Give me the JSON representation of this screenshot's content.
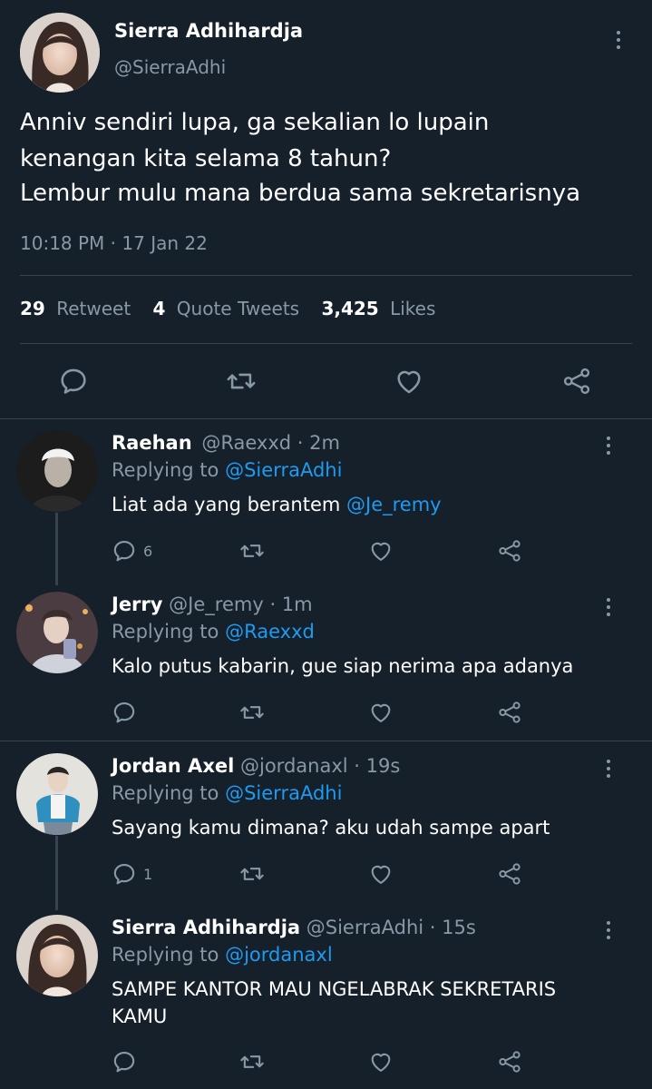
{
  "main_tweet": {
    "author_name": "Sierra Adhihardja",
    "author_handle": "@SierraAdhi",
    "text_lines": [
      "Anniv sendiri lupa, ga sekalian lo lupain",
      "kenangan kita selama 8 tahun?",
      "Lembur mulu mana berdua sama sekretarisnya"
    ],
    "timestamp": "10:18 PM · 17 Jan 22",
    "stats": {
      "retweets_count": "29",
      "retweets_label": "Retweet",
      "quotes_count": "4",
      "quotes_label": "Quote Tweets",
      "likes_count": "3,425",
      "likes_label": "Likes"
    }
  },
  "replies": [
    {
      "name": "Raehan",
      "handle": "@Raexxd",
      "time": "· 2m",
      "replying_prefix": "Replying to",
      "replying_to": "@SierraAdhi",
      "text_lines": [
        "Liat ada yang berantem "
      ],
      "mention": "@Je_remy",
      "reply_count": "6"
    },
    {
      "name": "Jerry",
      "handle": "@Je_remy",
      "time": "· 1m",
      "replying_prefix": "Replying to",
      "replying_to": "@Raexxd",
      "text_lines": [
        "Kalo putus kabarin, gue siap nerima apa adanya"
      ],
      "reply_count": ""
    },
    {
      "name": "Jordan Axel",
      "handle": "@jordanaxl",
      "time": "· 19s",
      "replying_prefix": "Replying to",
      "replying_to": "@SierraAdhi",
      "text_lines": [
        "Sayang kamu dimana? aku udah sampe apart"
      ],
      "reply_count": "1"
    },
    {
      "name": "Sierra Adhihardja",
      "handle": "@SierraAdhi",
      "time": "· 15s",
      "replying_prefix": "Replying to",
      "replying_to": "@jordanaxl",
      "text_lines": [
        "SAMPE KANTOR MAU NGELABRAK SEKRETARIS",
        "KAMU"
      ],
      "reply_count": ""
    }
  ],
  "icons": [
    "reply-icon",
    "retweet-icon",
    "like-icon",
    "share-icon",
    "more-icon"
  ],
  "colors": {
    "background": "#15202b",
    "text": "#ffffff",
    "secondary": "#8899a6",
    "link": "#1d9bf0",
    "divider": "#38444d"
  }
}
